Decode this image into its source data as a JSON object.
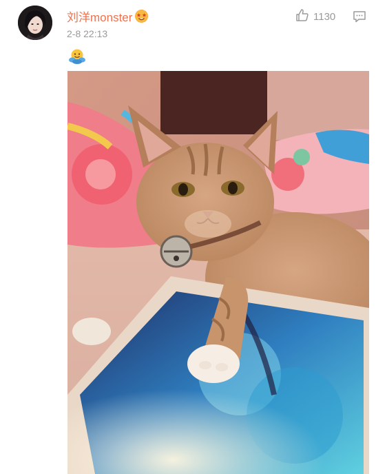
{
  "post": {
    "username": "刘洋monster",
    "timestamp": "2-8 22:13",
    "like_count": "1130"
  },
  "icons": {
    "verified_badge": "star-eyes-emoji-icon",
    "post_emoji": "hug-emoji-icon",
    "like": "thumbs-up-icon",
    "comment": "comment-icon"
  },
  "colors": {
    "username": "#eb7350",
    "meta_text": "#999999",
    "icon_gray": "#9a9a9a"
  }
}
